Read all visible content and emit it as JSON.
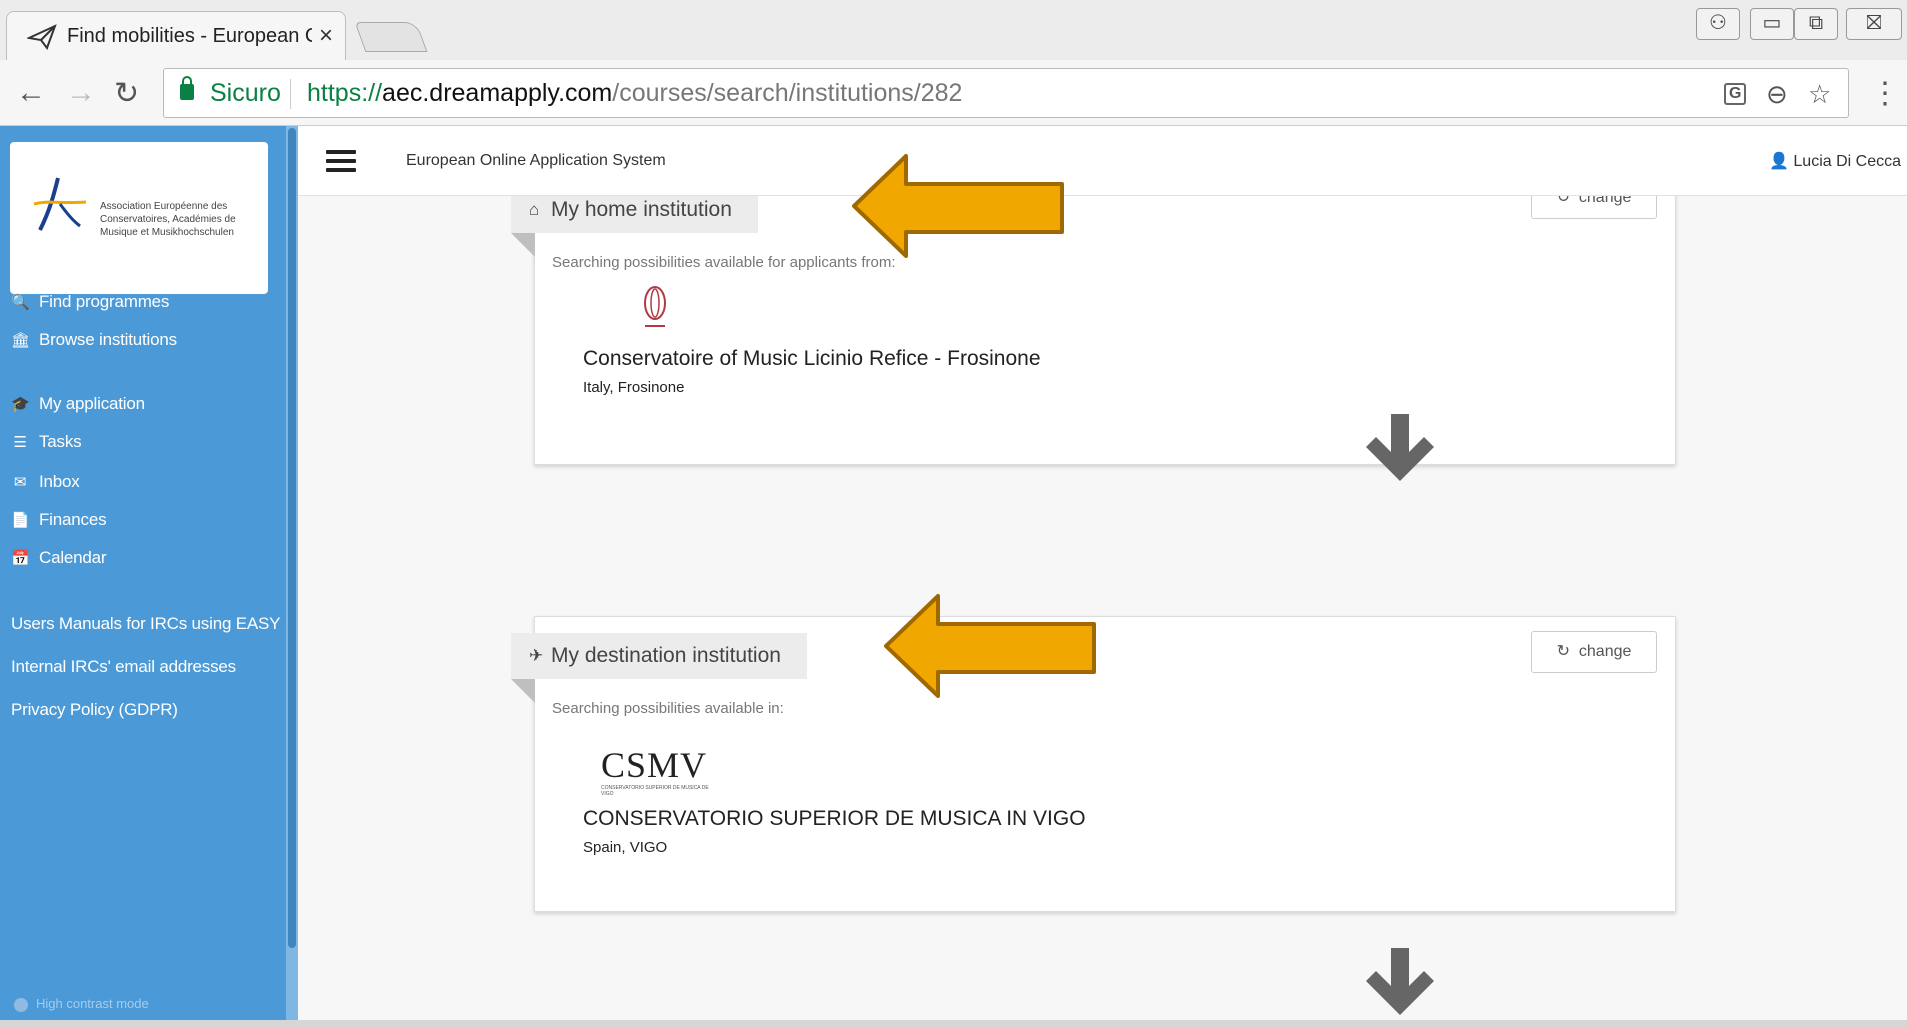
{
  "browser": {
    "tab_title": "Find mobilities - European C",
    "tab_close": "×",
    "secure_label": "Sicuro",
    "url_scheme": "https://",
    "url_host": "aec.dreamapply.com",
    "url_path": "/courses/search/institutions/282",
    "back_icon": "←",
    "forward_icon": "→",
    "reload_icon": "↻",
    "translate_icon": "G",
    "zoom_icon": "⊖",
    "star_icon": "☆",
    "menu_icon": "⋮",
    "win_user": "⚇",
    "win_min": "▭",
    "win_max": "⧉",
    "win_close": "⛝"
  },
  "sidebar": {
    "logo_text": "Association Européenne des Conservatoires, Académies de Musique et Musikhochschulen",
    "items": [
      {
        "icon": "🔍",
        "label": "Find programmes"
      },
      {
        "icon": "🏛",
        "label": "Browse institutions"
      },
      {
        "icon": "🎓",
        "label": "My application"
      },
      {
        "icon": "☰",
        "label": "Tasks"
      },
      {
        "icon": "✉",
        "label": "Inbox"
      },
      {
        "icon": "📄",
        "label": "Finances"
      },
      {
        "icon": "📅",
        "label": "Calendar"
      }
    ],
    "links": [
      "Users Manuals for IRCs using EASY",
      "Internal IRCs' email addresses",
      "Privacy Policy (GDPR)"
    ],
    "high_contrast": "High contrast mode"
  },
  "header": {
    "title": "European Online Application System",
    "user": "Lucia Di Cecca"
  },
  "home": {
    "heading": "My home institution",
    "change": "change",
    "subtitle": "Searching possibilities available for applicants from:",
    "name": "Conservatoire of Music Licinio Refice - Frosinone",
    "location": "Italy, Frosinone"
  },
  "destination": {
    "heading": "My destination institution",
    "change": "change",
    "subtitle": "Searching possibilities available in:",
    "logo_text": "CSMV",
    "logo_sub": "CONSERVATORIO SUPERIOR DE MUSICA DE VIGO",
    "name": "CONSERVATORIO SUPERIOR DE MUSICA IN VIGO",
    "location": "Spain, VIGO"
  },
  "colors": {
    "sidebar": "#4b99d6",
    "callout_arrow": "#f0a800",
    "secure_green": "#0b8043"
  },
  "icons": {
    "home_icon": "home-icon",
    "plane_icon": "plane-icon",
    "refresh_icon": "refresh-icon",
    "down_arrow": "arrow-down-icon"
  }
}
